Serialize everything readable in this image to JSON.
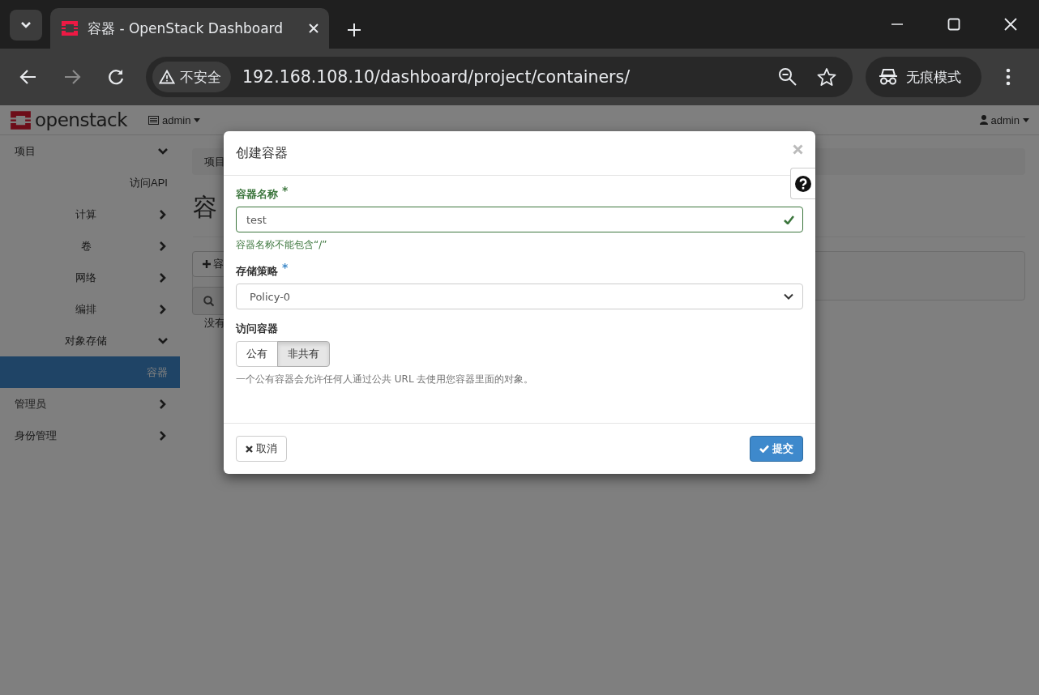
{
  "browser": {
    "tab_title": "容器 - OpenStack Dashboard",
    "security_label": "不安全",
    "url": "192.168.108.10/dashboard/project/containers/",
    "incognito_label": "无痕模式"
  },
  "header": {
    "logo_text": "openstack",
    "project_menu": "admin",
    "user_menu": "admin"
  },
  "sidebar": {
    "items": [
      {
        "kind": "group",
        "label": "项目",
        "expanded": true,
        "children": [
          {
            "kind": "link",
            "label": "访问API",
            "selected": false
          },
          {
            "kind": "group",
            "label": "计算",
            "expanded": false
          },
          {
            "kind": "group",
            "label": "卷",
            "expanded": false
          },
          {
            "kind": "group",
            "label": "网络",
            "expanded": false
          },
          {
            "kind": "group",
            "label": "编排",
            "expanded": false
          },
          {
            "kind": "group",
            "label": "对象存储",
            "expanded": true,
            "children": [
              {
                "kind": "link",
                "label": "容器",
                "selected": true
              }
            ]
          }
        ]
      },
      {
        "kind": "group",
        "label": "管理员",
        "expanded": false
      },
      {
        "kind": "group",
        "label": "身份管理",
        "expanded": false
      }
    ]
  },
  "content": {
    "breadcrumb": "项目",
    "page_title": "容",
    "create_button": "容",
    "empty_text": "没有"
  },
  "modal": {
    "title": "创建容器",
    "fields": [
      {
        "kind": "text",
        "label": "容器名称",
        "required_mark": "*",
        "valid": true,
        "value": "test",
        "help": "容器名称不能包含“/”"
      },
      {
        "kind": "select",
        "label": "存储策略",
        "required_mark": "*",
        "value": "Policy-0"
      },
      {
        "kind": "toggle",
        "label": "访问容器",
        "options": [
          {
            "label": "公有",
            "selected": false
          },
          {
            "label": "非共有",
            "selected": true
          }
        ],
        "help": "一个公有容器会允许任何人通过公共 URL 去使用您容器里面的对象。"
      }
    ],
    "buttons": [
      {
        "kind": "cancel",
        "label": "取消"
      },
      {
        "kind": "submit",
        "label": "提交"
      }
    ]
  }
}
